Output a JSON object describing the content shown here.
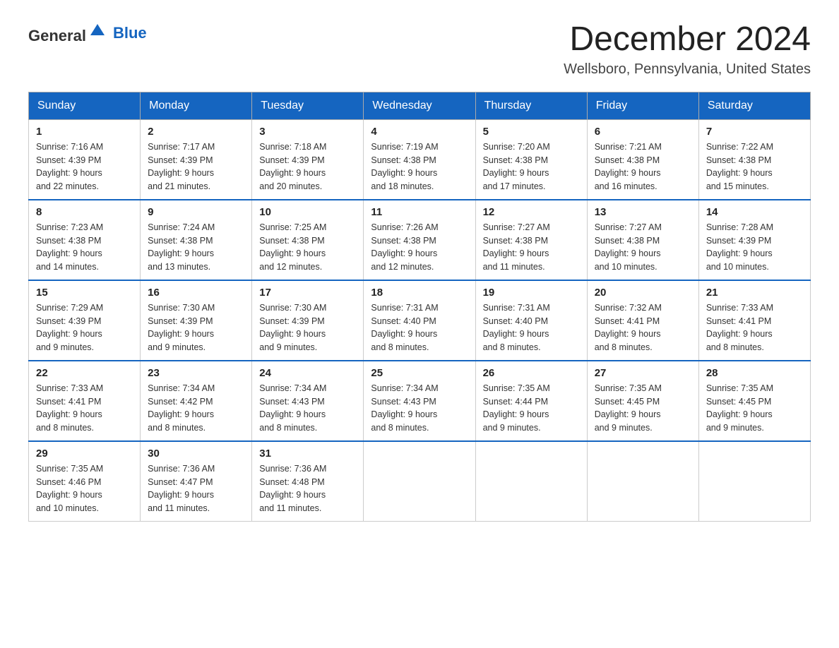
{
  "header": {
    "logo_general": "General",
    "logo_blue": "Blue",
    "month_year": "December 2024",
    "location": "Wellsboro, Pennsylvania, United States"
  },
  "days_of_week": [
    "Sunday",
    "Monday",
    "Tuesday",
    "Wednesday",
    "Thursday",
    "Friday",
    "Saturday"
  ],
  "weeks": [
    [
      {
        "day": "1",
        "sunrise": "7:16 AM",
        "sunset": "4:39 PM",
        "daylight": "9 hours and 22 minutes."
      },
      {
        "day": "2",
        "sunrise": "7:17 AM",
        "sunset": "4:39 PM",
        "daylight": "9 hours and 21 minutes."
      },
      {
        "day": "3",
        "sunrise": "7:18 AM",
        "sunset": "4:39 PM",
        "daylight": "9 hours and 20 minutes."
      },
      {
        "day": "4",
        "sunrise": "7:19 AM",
        "sunset": "4:38 PM",
        "daylight": "9 hours and 18 minutes."
      },
      {
        "day": "5",
        "sunrise": "7:20 AM",
        "sunset": "4:38 PM",
        "daylight": "9 hours and 17 minutes."
      },
      {
        "day": "6",
        "sunrise": "7:21 AM",
        "sunset": "4:38 PM",
        "daylight": "9 hours and 16 minutes."
      },
      {
        "day": "7",
        "sunrise": "7:22 AM",
        "sunset": "4:38 PM",
        "daylight": "9 hours and 15 minutes."
      }
    ],
    [
      {
        "day": "8",
        "sunrise": "7:23 AM",
        "sunset": "4:38 PM",
        "daylight": "9 hours and 14 minutes."
      },
      {
        "day": "9",
        "sunrise": "7:24 AM",
        "sunset": "4:38 PM",
        "daylight": "9 hours and 13 minutes."
      },
      {
        "day": "10",
        "sunrise": "7:25 AM",
        "sunset": "4:38 PM",
        "daylight": "9 hours and 12 minutes."
      },
      {
        "day": "11",
        "sunrise": "7:26 AM",
        "sunset": "4:38 PM",
        "daylight": "9 hours and 12 minutes."
      },
      {
        "day": "12",
        "sunrise": "7:27 AM",
        "sunset": "4:38 PM",
        "daylight": "9 hours and 11 minutes."
      },
      {
        "day": "13",
        "sunrise": "7:27 AM",
        "sunset": "4:38 PM",
        "daylight": "9 hours and 10 minutes."
      },
      {
        "day": "14",
        "sunrise": "7:28 AM",
        "sunset": "4:39 PM",
        "daylight": "9 hours and 10 minutes."
      }
    ],
    [
      {
        "day": "15",
        "sunrise": "7:29 AM",
        "sunset": "4:39 PM",
        "daylight": "9 hours and 9 minutes."
      },
      {
        "day": "16",
        "sunrise": "7:30 AM",
        "sunset": "4:39 PM",
        "daylight": "9 hours and 9 minutes."
      },
      {
        "day": "17",
        "sunrise": "7:30 AM",
        "sunset": "4:39 PM",
        "daylight": "9 hours and 9 minutes."
      },
      {
        "day": "18",
        "sunrise": "7:31 AM",
        "sunset": "4:40 PM",
        "daylight": "9 hours and 8 minutes."
      },
      {
        "day": "19",
        "sunrise": "7:31 AM",
        "sunset": "4:40 PM",
        "daylight": "9 hours and 8 minutes."
      },
      {
        "day": "20",
        "sunrise": "7:32 AM",
        "sunset": "4:41 PM",
        "daylight": "9 hours and 8 minutes."
      },
      {
        "day": "21",
        "sunrise": "7:33 AM",
        "sunset": "4:41 PM",
        "daylight": "9 hours and 8 minutes."
      }
    ],
    [
      {
        "day": "22",
        "sunrise": "7:33 AM",
        "sunset": "4:41 PM",
        "daylight": "9 hours and 8 minutes."
      },
      {
        "day": "23",
        "sunrise": "7:34 AM",
        "sunset": "4:42 PM",
        "daylight": "9 hours and 8 minutes."
      },
      {
        "day": "24",
        "sunrise": "7:34 AM",
        "sunset": "4:43 PM",
        "daylight": "9 hours and 8 minutes."
      },
      {
        "day": "25",
        "sunrise": "7:34 AM",
        "sunset": "4:43 PM",
        "daylight": "9 hours and 8 minutes."
      },
      {
        "day": "26",
        "sunrise": "7:35 AM",
        "sunset": "4:44 PM",
        "daylight": "9 hours and 9 minutes."
      },
      {
        "day": "27",
        "sunrise": "7:35 AM",
        "sunset": "4:45 PM",
        "daylight": "9 hours and 9 minutes."
      },
      {
        "day": "28",
        "sunrise": "7:35 AM",
        "sunset": "4:45 PM",
        "daylight": "9 hours and 9 minutes."
      }
    ],
    [
      {
        "day": "29",
        "sunrise": "7:35 AM",
        "sunset": "4:46 PM",
        "daylight": "9 hours and 10 minutes."
      },
      {
        "day": "30",
        "sunrise": "7:36 AM",
        "sunset": "4:47 PM",
        "daylight": "9 hours and 11 minutes."
      },
      {
        "day": "31",
        "sunrise": "7:36 AM",
        "sunset": "4:48 PM",
        "daylight": "9 hours and 11 minutes."
      },
      null,
      null,
      null,
      null
    ]
  ],
  "labels": {
    "sunrise": "Sunrise:",
    "sunset": "Sunset:",
    "daylight": "Daylight:"
  }
}
